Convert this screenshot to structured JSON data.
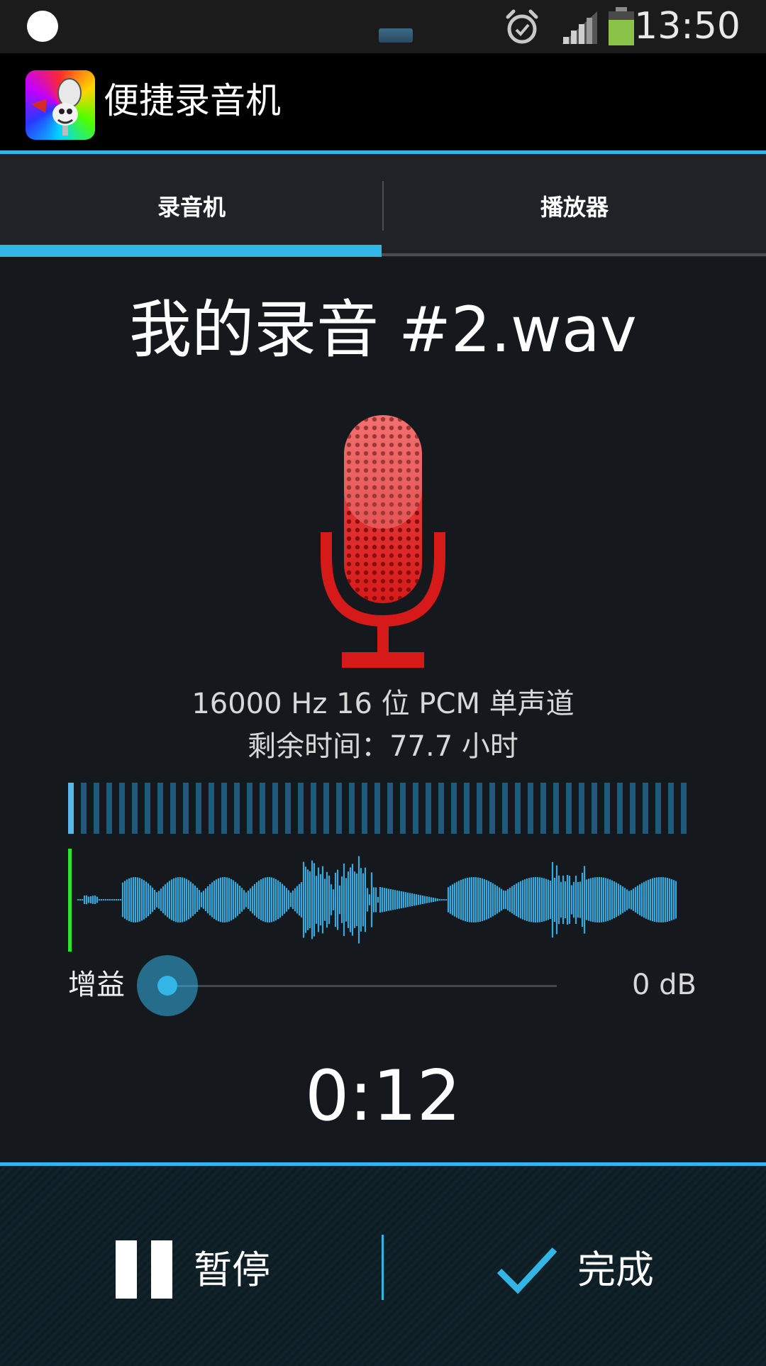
{
  "status_bar": {
    "time": "13:50",
    "icons": [
      "notification-dot",
      "alarm-icon",
      "signal-icon",
      "battery-icon"
    ]
  },
  "action_bar": {
    "title": "便捷录音机",
    "icon": "microphone-app-icon"
  },
  "tabs": [
    {
      "label": "录音机",
      "selected": true
    },
    {
      "label": "播放器",
      "selected": false
    }
  ],
  "recording": {
    "filename": "我的录音 #2.wav",
    "format": "16000 Hz 16 位 PCM 单声道",
    "remaining": "剩余时间：77.7 小时",
    "elapsed": "0:12"
  },
  "gain": {
    "label": "增益",
    "value": "0 dB",
    "level": 0
  },
  "controls": {
    "pause_label": "暂停",
    "done_label": "完成"
  },
  "colors": {
    "accent": "#33b5e5",
    "mic": "#d61a1a",
    "waveform": "#36a9dd",
    "cursor": "#2ee52e"
  }
}
